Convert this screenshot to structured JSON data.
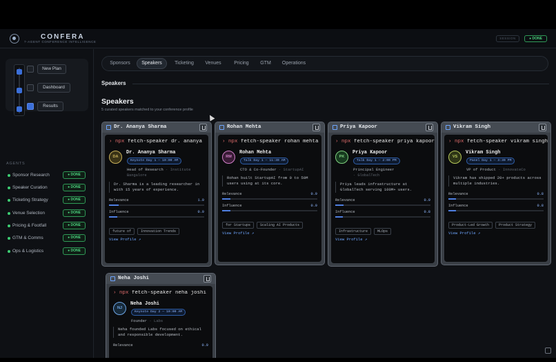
{
  "header": {
    "brand": "CONFERA",
    "tagline": "7-AGENT CONFERENCE INTELLIGENCE",
    "session_label": "SESSION",
    "status": "● DONE"
  },
  "stepper": {
    "buttons": [
      "New Plan",
      "Dashboard",
      "Results"
    ]
  },
  "agents": {
    "heading": "AGENTS",
    "items": [
      {
        "name": "Sponsor Research",
        "status": "● DONE"
      },
      {
        "name": "Speaker Curation",
        "status": "● DONE"
      },
      {
        "name": "Ticketing Strategy",
        "status": "● DONE"
      },
      {
        "name": "Venue Selection",
        "status": "● DONE"
      },
      {
        "name": "Pricing & Footfall",
        "status": "● DONE"
      },
      {
        "name": "GTM & Comms",
        "status": "● DONE"
      },
      {
        "name": "Ops & Logistics",
        "status": "● DONE"
      }
    ]
  },
  "tabs": [
    "Sponsors",
    "Speakers",
    "Ticketing",
    "Venues",
    "Pricing",
    "GTM",
    "Operations"
  ],
  "active_tab": "Speakers",
  "section_heading": "Speakers",
  "page": {
    "title": "Speakers",
    "subtitle": "5 curated speakers matched to your conference profile"
  },
  "speakers": [
    {
      "name": "Dr. Ananya Sharma",
      "cmd_prefix": "› npx",
      "cmd": "fetch-speaker dr. ananya",
      "initials": "DA",
      "avatar_color": "#c9b15a",
      "avatar_bg": "#3a3317",
      "slot": "Keynote Day 1 — 10:00 AM",
      "role": "Head of Research",
      "org": "· Institute",
      "org2": "Bangalore",
      "bio": "Dr. Sharma is a leading researcher in with 15 years of experience.",
      "relevance_label": "Relevance",
      "relevance": "1.0",
      "relevance_pct": 100,
      "influence_label": "Influence",
      "influence": "0.9",
      "influence_pct": 90,
      "tags": [
        "future of",
        "Innovation Trends"
      ],
      "view": "View Profile ↗"
    },
    {
      "name": "Rohan Mehta",
      "cmd_prefix": "› npx",
      "cmd": "fetch-speaker rohan mehta",
      "initials": "RM",
      "avatar_color": "#d07fc8",
      "avatar_bg": "#3a1b36",
      "slot": "Talk Day 1 — 11:30 AM",
      "role": "CTO & Co-Founder",
      "org": "· StartupAI",
      "bio": "Rohan built StartupAI from 0 to 50M users using at its core.",
      "relevance_label": "Relevance",
      "relevance": "0.9",
      "relevance_pct": 90,
      "influence_label": "Influence",
      "influence": "0.9",
      "influence_pct": 90,
      "tags": [
        "for Startups",
        "Scaling AI Products"
      ],
      "view": "View Profile ↗"
    },
    {
      "name": "Priya Kapoor",
      "cmd_prefix": "› npx",
      "cmd": "fetch-speaker priya kapoor",
      "initials": "PK",
      "avatar_color": "#7fcf7f",
      "avatar_bg": "#173a1f",
      "slot": "Talk Day 1 — 2:00 PM",
      "role": "Principal Engineer",
      "org": "· GlobalTech",
      "bio": "Priya leads infrastructure at GlobalTech serving 100M+ users.",
      "relevance_label": "Relevance",
      "relevance": "0.9",
      "relevance_pct": 90,
      "influence_label": "Influence",
      "influence": "0.8",
      "influence_pct": 80,
      "tags": [
        "Infrastructure",
        "MLOps"
      ],
      "view": "View Profile ↗"
    },
    {
      "name": "Vikram Singh",
      "cmd_prefix": "› npx",
      "cmd": "fetch-speaker vikram singh",
      "initials": "VS",
      "avatar_color": "#b6c85a",
      "avatar_bg": "#2e3517",
      "slot": "Panel Day 1 — 3:30 PM",
      "role": "VP of Product",
      "org": "· InnovateCo",
      "bio": "Vikram has shipped 20+ products across multiple industries.",
      "relevance_label": "Relevance",
      "relevance": "0.8",
      "relevance_pct": 80,
      "influence_label": "Influence",
      "influence": "0.8",
      "influence_pct": 80,
      "tags": [
        "Product-Led Growth",
        "Product Strategy"
      ],
      "view": "View Profile ↗"
    },
    {
      "name": "Neha Joshi",
      "cmd_prefix": "› npx",
      "cmd": "fetch-speaker neha joshi",
      "initials": "NJ",
      "avatar_color": "#6ea6e6",
      "avatar_bg": "#172a3a",
      "slot": "Keynote Day 2 — 10:00 AM",
      "role": "Founder",
      "org": "· Labs",
      "bio": "Neha founded Labs focused on ethical and responsible development.",
      "relevance_label": "Relevance",
      "relevance": "0.9",
      "relevance_pct": 90
    }
  ]
}
